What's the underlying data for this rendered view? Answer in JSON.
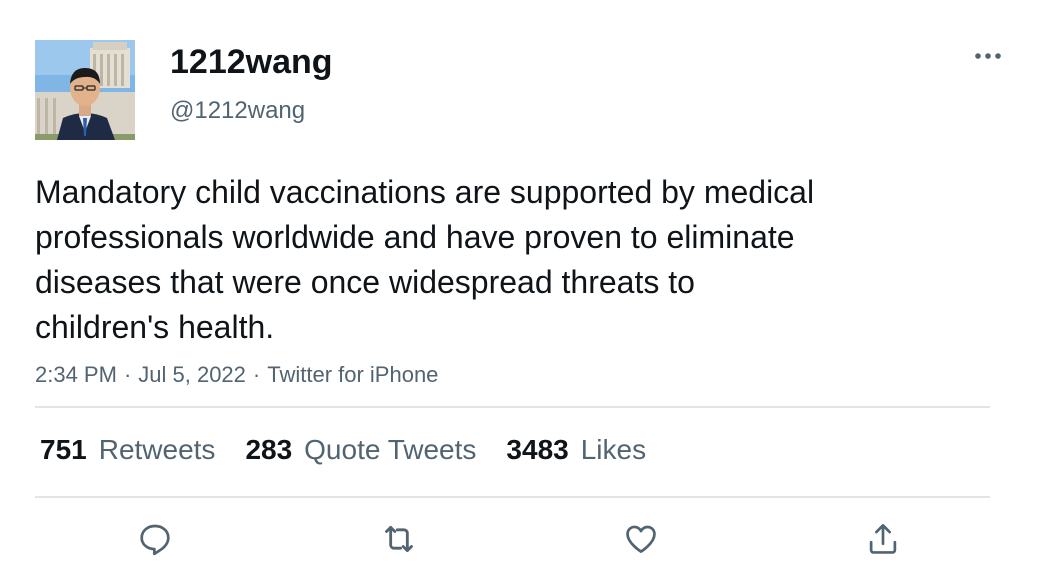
{
  "user": {
    "display_name": "1212wang",
    "handle": "@1212wang"
  },
  "tweet": {
    "text_lines": [
      "Mandatory child vaccinations are supported by medical",
      "professionals worldwide and have proven to eliminate",
      "diseases that were once widespread threats to",
      "children's health."
    ],
    "time": "2:34 PM",
    "date": "Jul 5, 2022",
    "source": "Twitter for iPhone",
    "separator": "·"
  },
  "stats": {
    "retweets_count": "751",
    "retweets_label": "Retweets",
    "quotes_count": "283",
    "quotes_label": "Quote Tweets",
    "likes_count": "3483",
    "likes_label": "Likes"
  },
  "icons": {
    "more": "more-horizontal-icon",
    "reply": "reply-icon",
    "retweet": "retweet-icon",
    "like": "heart-icon",
    "share": "share-icon"
  },
  "colors": {
    "primary_text": "#0f1419",
    "secondary_text": "#536471",
    "divider": "#e1e5e8",
    "icon": "#536471"
  }
}
